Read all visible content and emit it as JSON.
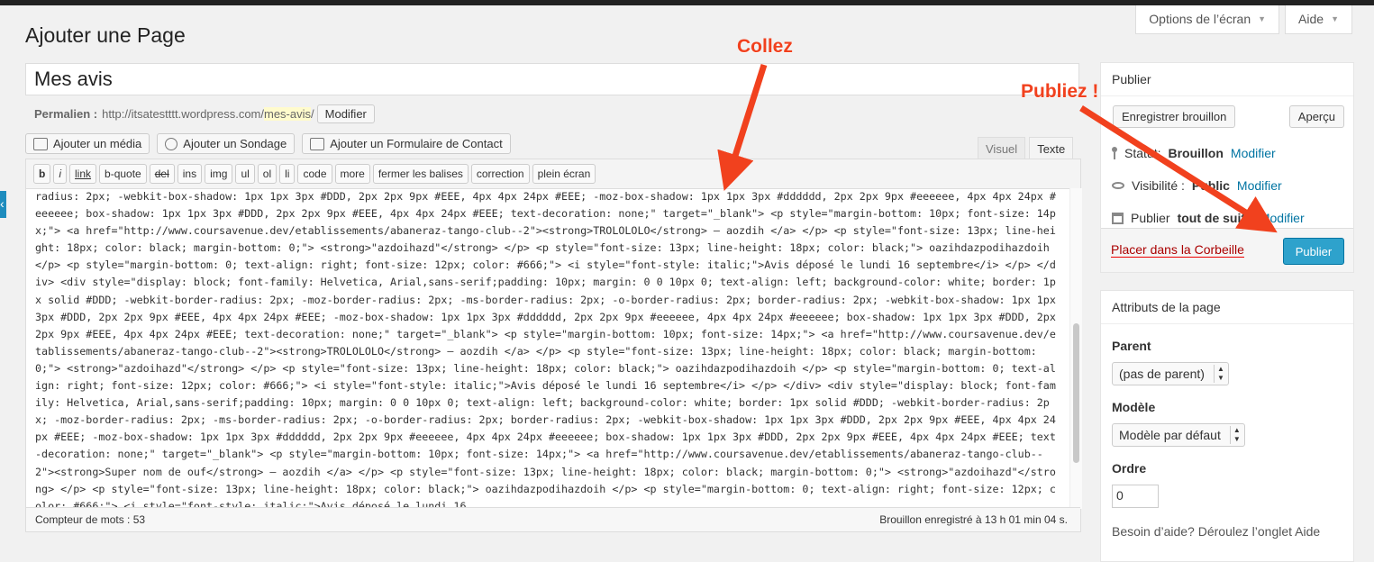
{
  "screen_options": {
    "label": "Options de l’écran"
  },
  "help_tab": {
    "label": "Aide"
  },
  "page_title": "Ajouter une Page",
  "post_title": "Mes avis",
  "permalink": {
    "label": "Permalien :",
    "base": "http://itsatestttt.wordpress.com/",
    "slug": "mes-avis",
    "suffix": "/",
    "edit_label": "Modifier"
  },
  "media_buttons": [
    "Ajouter un média",
    "Ajouter un Sondage",
    "Ajouter un Formulaire de Contact"
  ],
  "editor_tabs": [
    "Visuel",
    "Texte"
  ],
  "quicktags": [
    "b",
    "i",
    "link",
    "b-quote",
    "del",
    "ins",
    "img",
    "ul",
    "ol",
    "li",
    "code",
    "more",
    "fermer les balises",
    "correction",
    "plein écran"
  ],
  "content": "radius: 2px; -webkit-box-shadow: 1px 1px 3px #DDD, 2px 2px 9px #EEE, 4px 4px 24px #EEE; -moz-box-shadow: 1px 1px 3px #dddddd, 2px 2px 9px #eeeeee, 4px 4px 24px #eeeeee; box-shadow: 1px 1px 3px #DDD, 2px 2px 9px #EEE, 4px 4px 24px #EEE; text-decoration: none;\" target=\"_blank\"> <p style=\"margin-bottom: 10px; font-size: 14px;\"> <a href=\"http://www.coursavenue.dev/etablissements/abaneraz-tango-club--2\"><strong>TROLOLOLO</strong> – aozdih </a> </p> <p style=\"font-size: 13px; line-height: 18px; color: black; margin-bottom: 0;\"> <strong>\"azdoihazd\"</strong> </p> <p style=\"font-size: 13px; line-height: 18px; color: black;\"> oazihdazpodihazdoih </p> <p style=\"margin-bottom: 0; text-align: right; font-size: 12px; color: #666;\"> <i style=\"font-style: italic;\">Avis déposé le lundi 16 septembre</i> </p> </div> <div style=\"display: block; font-family: Helvetica, Arial,sans-serif;padding: 10px; margin: 0 0 10px 0; text-align: left; background-color: white; border: 1px solid #DDD; -webkit-border-radius: 2px; -moz-border-radius: 2px; -ms-border-radius: 2px; -o-border-radius: 2px; border-radius: 2px; -webkit-box-shadow: 1px 1px 3px #DDD, 2px 2px 9px #EEE, 4px 4px 24px #EEE; -moz-box-shadow: 1px 1px 3px #dddddd, 2px 2px 9px #eeeeee, 4px 4px 24px #eeeeee; box-shadow: 1px 1px 3px #DDD, 2px 2px 9px #EEE, 4px 4px 24px #EEE; text-decoration: none;\" target=\"_blank\"> <p style=\"margin-bottom: 10px; font-size: 14px;\"> <a href=\"http://www.coursavenue.dev/etablissements/abaneraz-tango-club--2\"><strong>TROLOLOLO</strong> – aozdih </a> </p> <p style=\"font-size: 13px; line-height: 18px; color: black; margin-bottom: 0;\"> <strong>\"azdoihazd\"</strong> </p> <p style=\"font-size: 13px; line-height: 18px; color: black;\"> oazihdazpodihazdoih </p> <p style=\"margin-bottom: 0; text-align: right; font-size: 12px; color: #666;\"> <i style=\"font-style: italic;\">Avis déposé le lundi 16 septembre</i> </p> </div> <div style=\"display: block; font-family: Helvetica, Arial,sans-serif;padding: 10px; margin: 0 0 10px 0; text-align: left; background-color: white; border: 1px solid #DDD; -webkit-border-radius: 2px; -moz-border-radius: 2px; -ms-border-radius: 2px; -o-border-radius: 2px; border-radius: 2px; -webkit-box-shadow: 1px 1px 3px #DDD, 2px 2px 9px #EEE, 4px 4px 24px #EEE; -moz-box-shadow: 1px 1px 3px #dddddd, 2px 2px 9px #eeeeee, 4px 4px 24px #eeeeee; box-shadow: 1px 1px 3px #DDD, 2px 2px 9px #EEE, 4px 4px 24px #EEE; text-decoration: none;\" target=\"_blank\"> <p style=\"margin-bottom: 10px; font-size: 14px;\"> <a href=\"http://www.coursavenue.dev/etablissements/abaneraz-tango-club--2\"><strong>Super nom de ouf</strong> – aozdih </a> </p> <p style=\"font-size: 13px; line-height: 18px; color: black; margin-bottom: 0;\"> <strong>\"azdoihazd\"</strong> </p> <p style=\"font-size: 13px; line-height: 18px; color: black;\"> oazihdazpodihazdoih </p> <p style=\"margin-bottom: 0; text-align: right; font-size: 12px; color: #666;\"> <i style=\"font-style: italic;\">Avis déposé le lundi 16",
  "word_count": "Compteur de mots : 53",
  "draft_saved": "Brouillon enregistré à 13 h 01 min 04 s.",
  "publish_box": {
    "title": "Publier",
    "save_draft": "Enregistrer brouillon",
    "preview": "Aperçu",
    "status_label": "Statut:",
    "status_value": "Brouillon",
    "visibility_label": "Visibilité :",
    "visibility_value": "Public",
    "schedule_text": "Publier",
    "schedule_value": "tout de suite",
    "modify": "Modifier",
    "trash": "Placer dans la Corbeille",
    "publish": "Publier"
  },
  "attributes_box": {
    "title": "Attributs de la page",
    "parent_label": "Parent",
    "parent_value": "(pas de parent)",
    "template_label": "Modèle",
    "template_value": "Modèle par défaut",
    "order_label": "Ordre",
    "order_value": "0",
    "help": "Besoin d’aide? Déroulez l’onglet Aide"
  },
  "annotations": {
    "paste": "Collez",
    "publish": "Publiez !"
  },
  "colors": {
    "accent": "#2ea2cc",
    "annotation": "#f1411e",
    "trash": "#a00000"
  }
}
